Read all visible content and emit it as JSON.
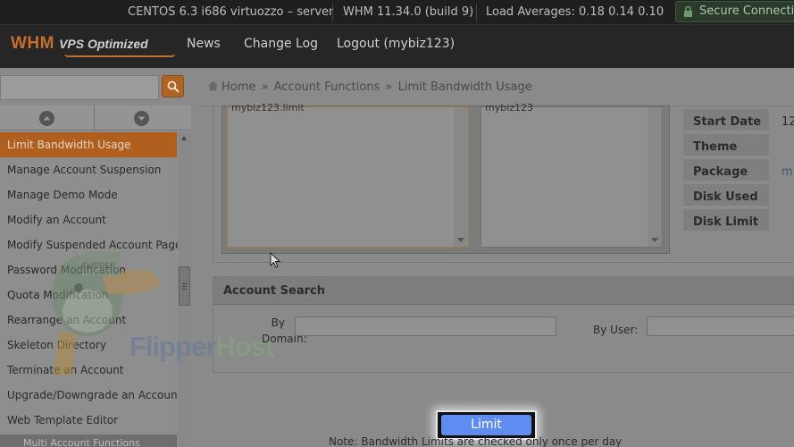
{
  "topbar": {
    "os": "CENTOS 6.3 i686 virtuozzo – server",
    "version": "WHM 11.34.0 (build 9)",
    "load": "Load Averages: 0.18 0.14 0.10",
    "secure": "Secure Connection"
  },
  "header": {
    "logo_whm": "WHM",
    "logo_vps": "VPS Optimized",
    "nav": [
      "News",
      "Change Log",
      "Logout (mybiz123)"
    ]
  },
  "breadcrumb": {
    "home": "Home",
    "sep": "»",
    "section": "Account Functions",
    "page": "Limit Bandwidth Usage"
  },
  "sidebar": {
    "items": [
      "Limit Bandwidth Usage",
      "Manage Account Suspension",
      "Manage Demo Mode",
      "Modify an Account",
      "Modify Suspended Account Page",
      "Password Modification",
      "Quota Modification",
      "Rearrange an Account",
      "Skeleton Directory",
      "Terminate an Account",
      "Upgrade/Downgrade an Account",
      "Web Template Editor"
    ],
    "next_section": "Multi Account Functions"
  },
  "lists": {
    "left_item": "mybiz123.limit",
    "right_item": "mybiz123"
  },
  "info_table": {
    "rows": [
      {
        "label": "Start Date",
        "value": "12"
      },
      {
        "label": "Theme",
        "value": ""
      },
      {
        "label": "Package",
        "value": "m"
      },
      {
        "label": "Disk Used",
        "value": ""
      },
      {
        "label": "Disk Limit",
        "value": ""
      }
    ]
  },
  "account_search": {
    "title": "Account Search",
    "by_domain": "By Domain:",
    "by_user": "By User:"
  },
  "limit_button": "Limit",
  "note": "Note: Bandwidth Limits are checked only once per day",
  "watermark": {
    "flipper": "Flipper",
    "host": "Host",
    "badge": "FLIPPER"
  },
  "colors": {
    "accent": "#b05f1e",
    "button": "#5e8cf0",
    "topbar": "#1f1f1f"
  }
}
